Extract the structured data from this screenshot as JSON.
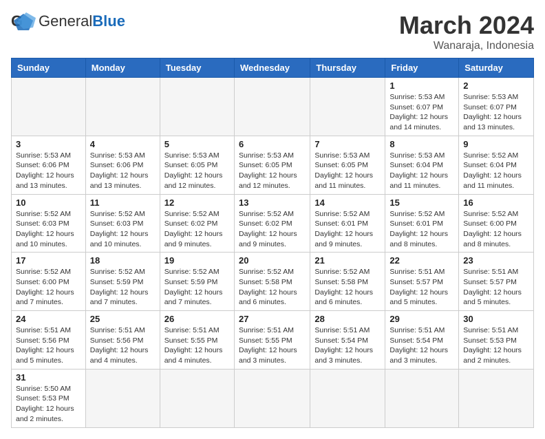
{
  "header": {
    "logo_general": "General",
    "logo_blue": "Blue",
    "month_title": "March 2024",
    "location": "Wanaraja, Indonesia"
  },
  "weekdays": [
    "Sunday",
    "Monday",
    "Tuesday",
    "Wednesday",
    "Thursday",
    "Friday",
    "Saturday"
  ],
  "weeks": [
    [
      {
        "day": "",
        "info": ""
      },
      {
        "day": "",
        "info": ""
      },
      {
        "day": "",
        "info": ""
      },
      {
        "day": "",
        "info": ""
      },
      {
        "day": "",
        "info": ""
      },
      {
        "day": "1",
        "info": "Sunrise: 5:53 AM\nSunset: 6:07 PM\nDaylight: 12 hours and 14 minutes."
      },
      {
        "day": "2",
        "info": "Sunrise: 5:53 AM\nSunset: 6:07 PM\nDaylight: 12 hours and 13 minutes."
      }
    ],
    [
      {
        "day": "3",
        "info": "Sunrise: 5:53 AM\nSunset: 6:06 PM\nDaylight: 12 hours and 13 minutes."
      },
      {
        "day": "4",
        "info": "Sunrise: 5:53 AM\nSunset: 6:06 PM\nDaylight: 12 hours and 13 minutes."
      },
      {
        "day": "5",
        "info": "Sunrise: 5:53 AM\nSunset: 6:05 PM\nDaylight: 12 hours and 12 minutes."
      },
      {
        "day": "6",
        "info": "Sunrise: 5:53 AM\nSunset: 6:05 PM\nDaylight: 12 hours and 12 minutes."
      },
      {
        "day": "7",
        "info": "Sunrise: 5:53 AM\nSunset: 6:05 PM\nDaylight: 12 hours and 11 minutes."
      },
      {
        "day": "8",
        "info": "Sunrise: 5:53 AM\nSunset: 6:04 PM\nDaylight: 12 hours and 11 minutes."
      },
      {
        "day": "9",
        "info": "Sunrise: 5:52 AM\nSunset: 6:04 PM\nDaylight: 12 hours and 11 minutes."
      }
    ],
    [
      {
        "day": "10",
        "info": "Sunrise: 5:52 AM\nSunset: 6:03 PM\nDaylight: 12 hours and 10 minutes."
      },
      {
        "day": "11",
        "info": "Sunrise: 5:52 AM\nSunset: 6:03 PM\nDaylight: 12 hours and 10 minutes."
      },
      {
        "day": "12",
        "info": "Sunrise: 5:52 AM\nSunset: 6:02 PM\nDaylight: 12 hours and 9 minutes."
      },
      {
        "day": "13",
        "info": "Sunrise: 5:52 AM\nSunset: 6:02 PM\nDaylight: 12 hours and 9 minutes."
      },
      {
        "day": "14",
        "info": "Sunrise: 5:52 AM\nSunset: 6:01 PM\nDaylight: 12 hours and 9 minutes."
      },
      {
        "day": "15",
        "info": "Sunrise: 5:52 AM\nSunset: 6:01 PM\nDaylight: 12 hours and 8 minutes."
      },
      {
        "day": "16",
        "info": "Sunrise: 5:52 AM\nSunset: 6:00 PM\nDaylight: 12 hours and 8 minutes."
      }
    ],
    [
      {
        "day": "17",
        "info": "Sunrise: 5:52 AM\nSunset: 6:00 PM\nDaylight: 12 hours and 7 minutes."
      },
      {
        "day": "18",
        "info": "Sunrise: 5:52 AM\nSunset: 5:59 PM\nDaylight: 12 hours and 7 minutes."
      },
      {
        "day": "19",
        "info": "Sunrise: 5:52 AM\nSunset: 5:59 PM\nDaylight: 12 hours and 7 minutes."
      },
      {
        "day": "20",
        "info": "Sunrise: 5:52 AM\nSunset: 5:58 PM\nDaylight: 12 hours and 6 minutes."
      },
      {
        "day": "21",
        "info": "Sunrise: 5:52 AM\nSunset: 5:58 PM\nDaylight: 12 hours and 6 minutes."
      },
      {
        "day": "22",
        "info": "Sunrise: 5:51 AM\nSunset: 5:57 PM\nDaylight: 12 hours and 5 minutes."
      },
      {
        "day": "23",
        "info": "Sunrise: 5:51 AM\nSunset: 5:57 PM\nDaylight: 12 hours and 5 minutes."
      }
    ],
    [
      {
        "day": "24",
        "info": "Sunrise: 5:51 AM\nSunset: 5:56 PM\nDaylight: 12 hours and 5 minutes."
      },
      {
        "day": "25",
        "info": "Sunrise: 5:51 AM\nSunset: 5:56 PM\nDaylight: 12 hours and 4 minutes."
      },
      {
        "day": "26",
        "info": "Sunrise: 5:51 AM\nSunset: 5:55 PM\nDaylight: 12 hours and 4 minutes."
      },
      {
        "day": "27",
        "info": "Sunrise: 5:51 AM\nSunset: 5:55 PM\nDaylight: 12 hours and 3 minutes."
      },
      {
        "day": "28",
        "info": "Sunrise: 5:51 AM\nSunset: 5:54 PM\nDaylight: 12 hours and 3 minutes."
      },
      {
        "day": "29",
        "info": "Sunrise: 5:51 AM\nSunset: 5:54 PM\nDaylight: 12 hours and 3 minutes."
      },
      {
        "day": "30",
        "info": "Sunrise: 5:51 AM\nSunset: 5:53 PM\nDaylight: 12 hours and 2 minutes."
      }
    ],
    [
      {
        "day": "31",
        "info": "Sunrise: 5:50 AM\nSunset: 5:53 PM\nDaylight: 12 hours and 2 minutes."
      },
      {
        "day": "",
        "info": ""
      },
      {
        "day": "",
        "info": ""
      },
      {
        "day": "",
        "info": ""
      },
      {
        "day": "",
        "info": ""
      },
      {
        "day": "",
        "info": ""
      },
      {
        "day": "",
        "info": ""
      }
    ]
  ]
}
